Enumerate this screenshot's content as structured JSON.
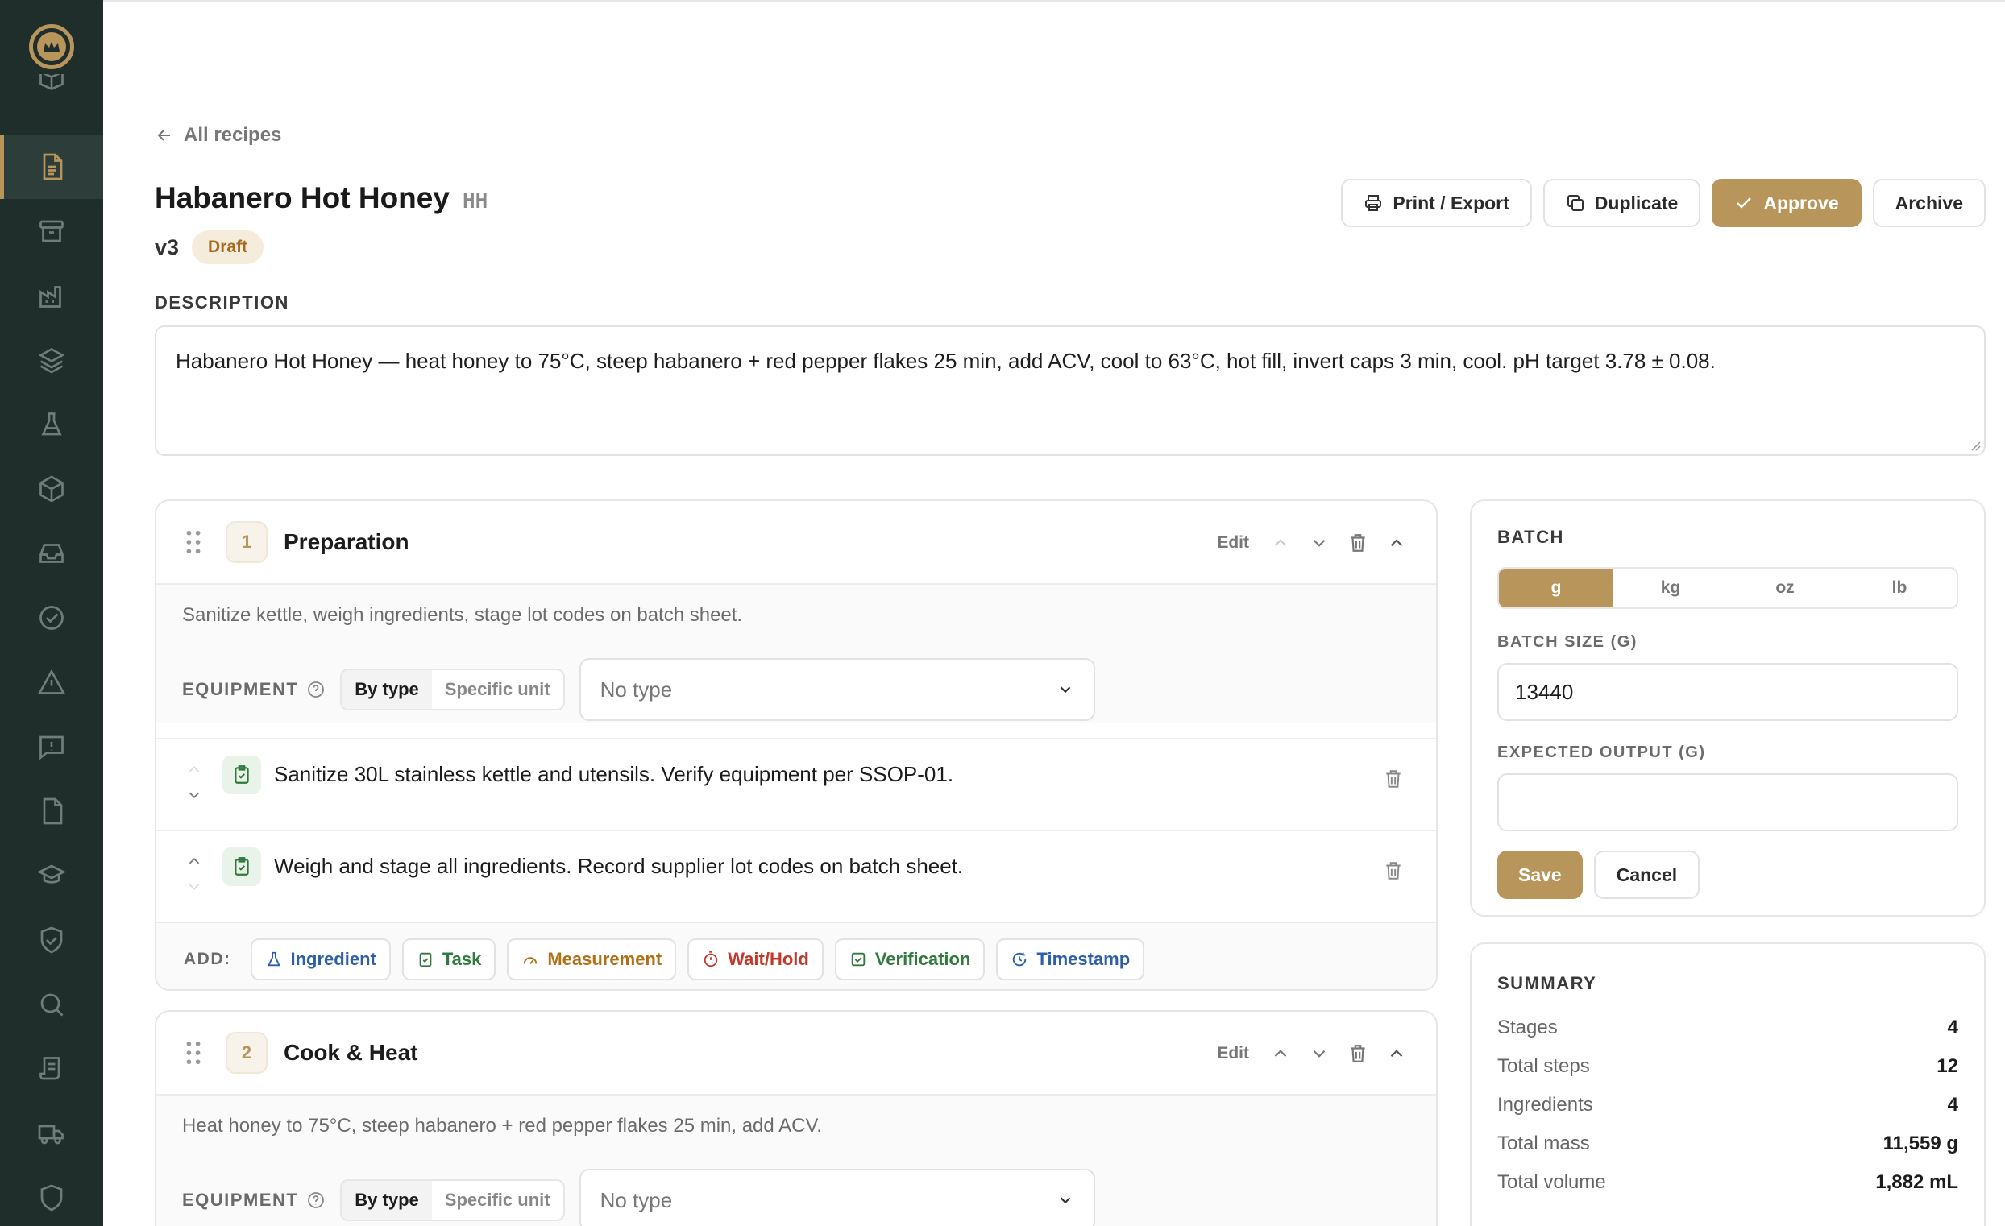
{
  "colors": {
    "accent": "#b8955a",
    "sidebar": "#1f2d2b",
    "draft_badge_bg": "#f6ecdc",
    "draft_badge_text": "#a46b1f"
  },
  "sidebar": {
    "items": [
      {
        "icon": "box-icon"
      },
      {
        "icon": "document-icon",
        "active": true
      },
      {
        "icon": "archive-icon"
      },
      {
        "icon": "factory-icon"
      },
      {
        "icon": "layers-icon"
      },
      {
        "icon": "flask-icon"
      },
      {
        "icon": "cube-icon"
      },
      {
        "icon": "inbox-icon"
      },
      {
        "icon": "check-circle-icon"
      },
      {
        "icon": "alert-triangle-icon"
      },
      {
        "icon": "message-alert-icon"
      },
      {
        "icon": "file-icon"
      },
      {
        "icon": "graduation-cap-icon"
      },
      {
        "icon": "shield-check-icon"
      },
      {
        "icon": "search-icon"
      },
      {
        "icon": "scroll-icon"
      },
      {
        "icon": "truck-icon"
      },
      {
        "icon": "shield-icon"
      }
    ]
  },
  "header": {
    "back_label": "All recipes",
    "title": "Habanero Hot Honey",
    "code": "HH",
    "version": "v3",
    "status": "Draft"
  },
  "actions": {
    "print": "Print / Export",
    "duplicate": "Duplicate",
    "approve": "Approve",
    "archive": "Archive"
  },
  "description": {
    "label": "DESCRIPTION",
    "text": "Habanero Hot Honey — heat honey to 75°C, steep habanero + red pepper flakes 25 min, add ACV, cool to 63°C, hot fill, invert caps 3 min, cool. pH target 3.78 ± 0.08."
  },
  "common": {
    "edit": "Edit",
    "equipment_label": "EQUIPMENT",
    "by_type": "By type",
    "specific_unit": "Specific unit",
    "no_type": "No type",
    "add_label": "ADD:"
  },
  "stages": [
    {
      "number": "1",
      "title": "Preparation",
      "description": "Sanitize kettle, weigh ingredients, stage lot codes on batch sheet.",
      "steps": [
        {
          "text": "Sanitize 30L stainless kettle and utensils. Verify equipment per SSOP-01."
        },
        {
          "text": "Weigh and stage all ingredients. Record supplier lot codes on batch sheet."
        }
      ]
    },
    {
      "number": "2",
      "title": "Cook & Heat",
      "description": "Heat honey to 75°C, steep habanero + red pepper flakes 25 min, add ACV."
    }
  ],
  "add_chips": [
    {
      "label": "Ingredient",
      "color": "#2f5fa8"
    },
    {
      "label": "Task",
      "color": "#2f7a3d"
    },
    {
      "label": "Measurement",
      "color": "#b07016"
    },
    {
      "label": "Wait/Hold",
      "color": "#c0392b"
    },
    {
      "label": "Verification",
      "color": "#2f7a3d"
    },
    {
      "label": "Timestamp",
      "color": "#2f5fa8"
    }
  ],
  "batch": {
    "title": "BATCH",
    "units": [
      "g",
      "kg",
      "oz",
      "lb"
    ],
    "selected_unit": "g",
    "batch_size_label": "BATCH SIZE (G)",
    "batch_size_value": "13440",
    "expected_output_label": "EXPECTED OUTPUT (G)",
    "expected_output_value": "",
    "save": "Save",
    "cancel": "Cancel"
  },
  "summary": {
    "title": "SUMMARY",
    "rows": [
      {
        "label": "Stages",
        "value": "4"
      },
      {
        "label": "Total steps",
        "value": "12"
      },
      {
        "label": "Ingredients",
        "value": "4"
      },
      {
        "label": "Total mass",
        "value": "11,559 g"
      },
      {
        "label": "Total volume",
        "value": "1,882 mL"
      }
    ]
  }
}
